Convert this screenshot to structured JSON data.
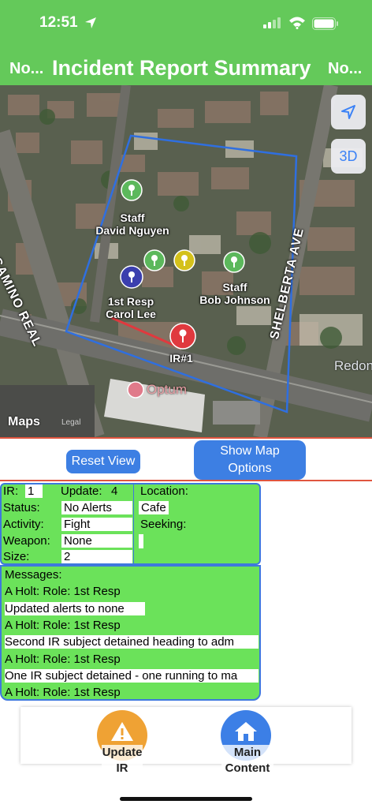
{
  "status_bar": {
    "time": "12:51"
  },
  "header": {
    "left_label": "No...",
    "title": "Incident Report Summary",
    "right_label": "No..."
  },
  "map": {
    "streets": [
      "S CAMINO REAL",
      "SHELBERTA AVE"
    ],
    "places": [
      "Optum",
      "Redon"
    ],
    "pins": [
      {
        "label_line1": "Staff",
        "label_line2": "David Nguyen",
        "color": "#5cb85c"
      },
      {
        "label_line1": "Staff",
        "label_line2": "Bob Johnson",
        "color": "#5cb85c"
      },
      {
        "label_line1": "1st Resp",
        "label_line2": "Carol Lee",
        "color": "#3b3fae"
      },
      {
        "label_line1": "IR#1",
        "label_line2": "",
        "color": "#e0393e"
      }
    ],
    "locate_icon": "location-arrow-icon",
    "three_d_label": "3D",
    "attribution": "Maps",
    "legal": "Legal",
    "boundary_color": "#2f6fe0",
    "route_color": "#e0393e"
  },
  "controls": {
    "reset_label": "Reset View",
    "options_label_line1": "Show Map",
    "options_label_line2": "Options"
  },
  "info": {
    "ir_label": "IR:",
    "ir_value": "1",
    "update_label": "Update:",
    "update_value": "4",
    "location_label": "Location:",
    "location_value": "Cafe",
    "status_label": "Status:",
    "status_value": "No Alerts",
    "seeking_label": "Seeking:",
    "seeking_value": "",
    "activity_label": "Activity:",
    "activity_value": "Fight",
    "weapon_label": "Weapon:",
    "weapon_value": "None",
    "size_label": "Size:",
    "size_value": "2"
  },
  "messages": {
    "heading": "Messages:",
    "items": [
      "A Holt: Role: 1st Resp",
      " Updated alerts to none",
      "A Holt: Role: 1st Resp",
      "Second IR subject detained heading to adm",
      "A Holt: Role: 1st Resp",
      "One IR subject detained - one running to ma",
      "A Holt: Role: 1st Resp"
    ]
  },
  "tabs": [
    {
      "label_line1": "Update",
      "label_line2": "IR",
      "icon": "alert-triangle-icon",
      "color": "#efa234"
    },
    {
      "label_line1": "Main",
      "label_line2": "Content",
      "icon": "home-icon",
      "color": "#3c7fe6"
    }
  ]
}
